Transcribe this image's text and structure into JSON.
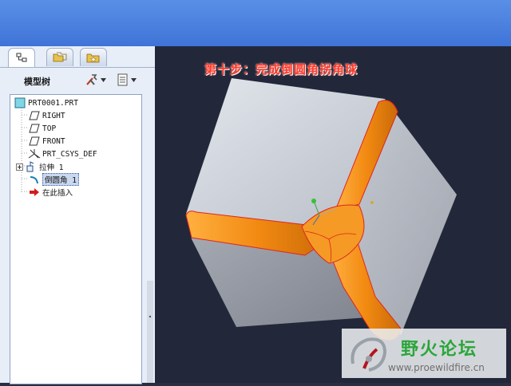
{
  "left_panel": {
    "tree_title": "模型树",
    "tabs": [
      "model-tree",
      "folder-browser",
      "favorites"
    ],
    "tree_items": [
      {
        "label": "PRT0001.PRT",
        "icon": "part-icon"
      },
      {
        "label": "RIGHT",
        "icon": "datum-plane-icon"
      },
      {
        "label": "TOP",
        "icon": "datum-plane-icon"
      },
      {
        "label": "FRONT",
        "icon": "datum-plane-icon"
      },
      {
        "label": "PRT_CSYS_DEF",
        "icon": "csys-icon"
      },
      {
        "label": "拉伸 1",
        "icon": "extrude-icon"
      },
      {
        "label": "倒圆角 1",
        "icon": "round-icon"
      },
      {
        "label": "在此插入",
        "icon": "insert-here-arrow-icon"
      }
    ]
  },
  "viewport": {
    "heading": "第十步：完成倒圆角拐角球"
  },
  "watermark": {
    "title": "野火论坛",
    "url": "www.proewildfire.cn"
  },
  "colors": {
    "titlebar": "#4a80df",
    "viewport_bg": "#22283a",
    "cube_face": "#c8ccd4",
    "fillet": "#f28a12",
    "edge": "#e0241c",
    "heading": "#ff3a2a",
    "watermark_green": "#2aa63a"
  }
}
